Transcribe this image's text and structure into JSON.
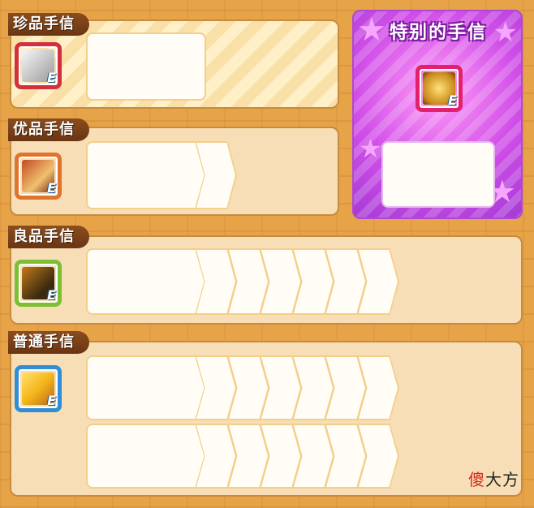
{
  "sections": [
    {
      "title": "珍品手信",
      "frame_color": "#d3303b",
      "art_colors": [
        "#f2f2f2",
        "#8c8c8c"
      ],
      "slot_rows": 1,
      "chevrons": 0
    },
    {
      "title": "优品手信",
      "frame_color": "#e0742d",
      "art_colors": [
        "#b53a1d",
        "#f0c070"
      ],
      "slot_rows": 1,
      "chevrons": 1
    },
    {
      "title": "良品手信",
      "frame_color": "#7bbf32",
      "art_colors": [
        "#b56a15",
        "#3a2a10"
      ],
      "slot_rows": 1,
      "chevrons": 6
    },
    {
      "title": "普通手信",
      "frame_color": "#2f8ed6",
      "art_colors": [
        "#f5c21a",
        "#c9781a"
      ],
      "slot_rows": 2,
      "chevrons": 6
    }
  ],
  "special": {
    "title": "特别的手信",
    "frame_color": "#e2206b",
    "art_colors": [
      "#f2c23a",
      "#8a5a10"
    ]
  },
  "badge_letter": "E",
  "watermark": {
    "first": "傻",
    "rest": "大方"
  }
}
